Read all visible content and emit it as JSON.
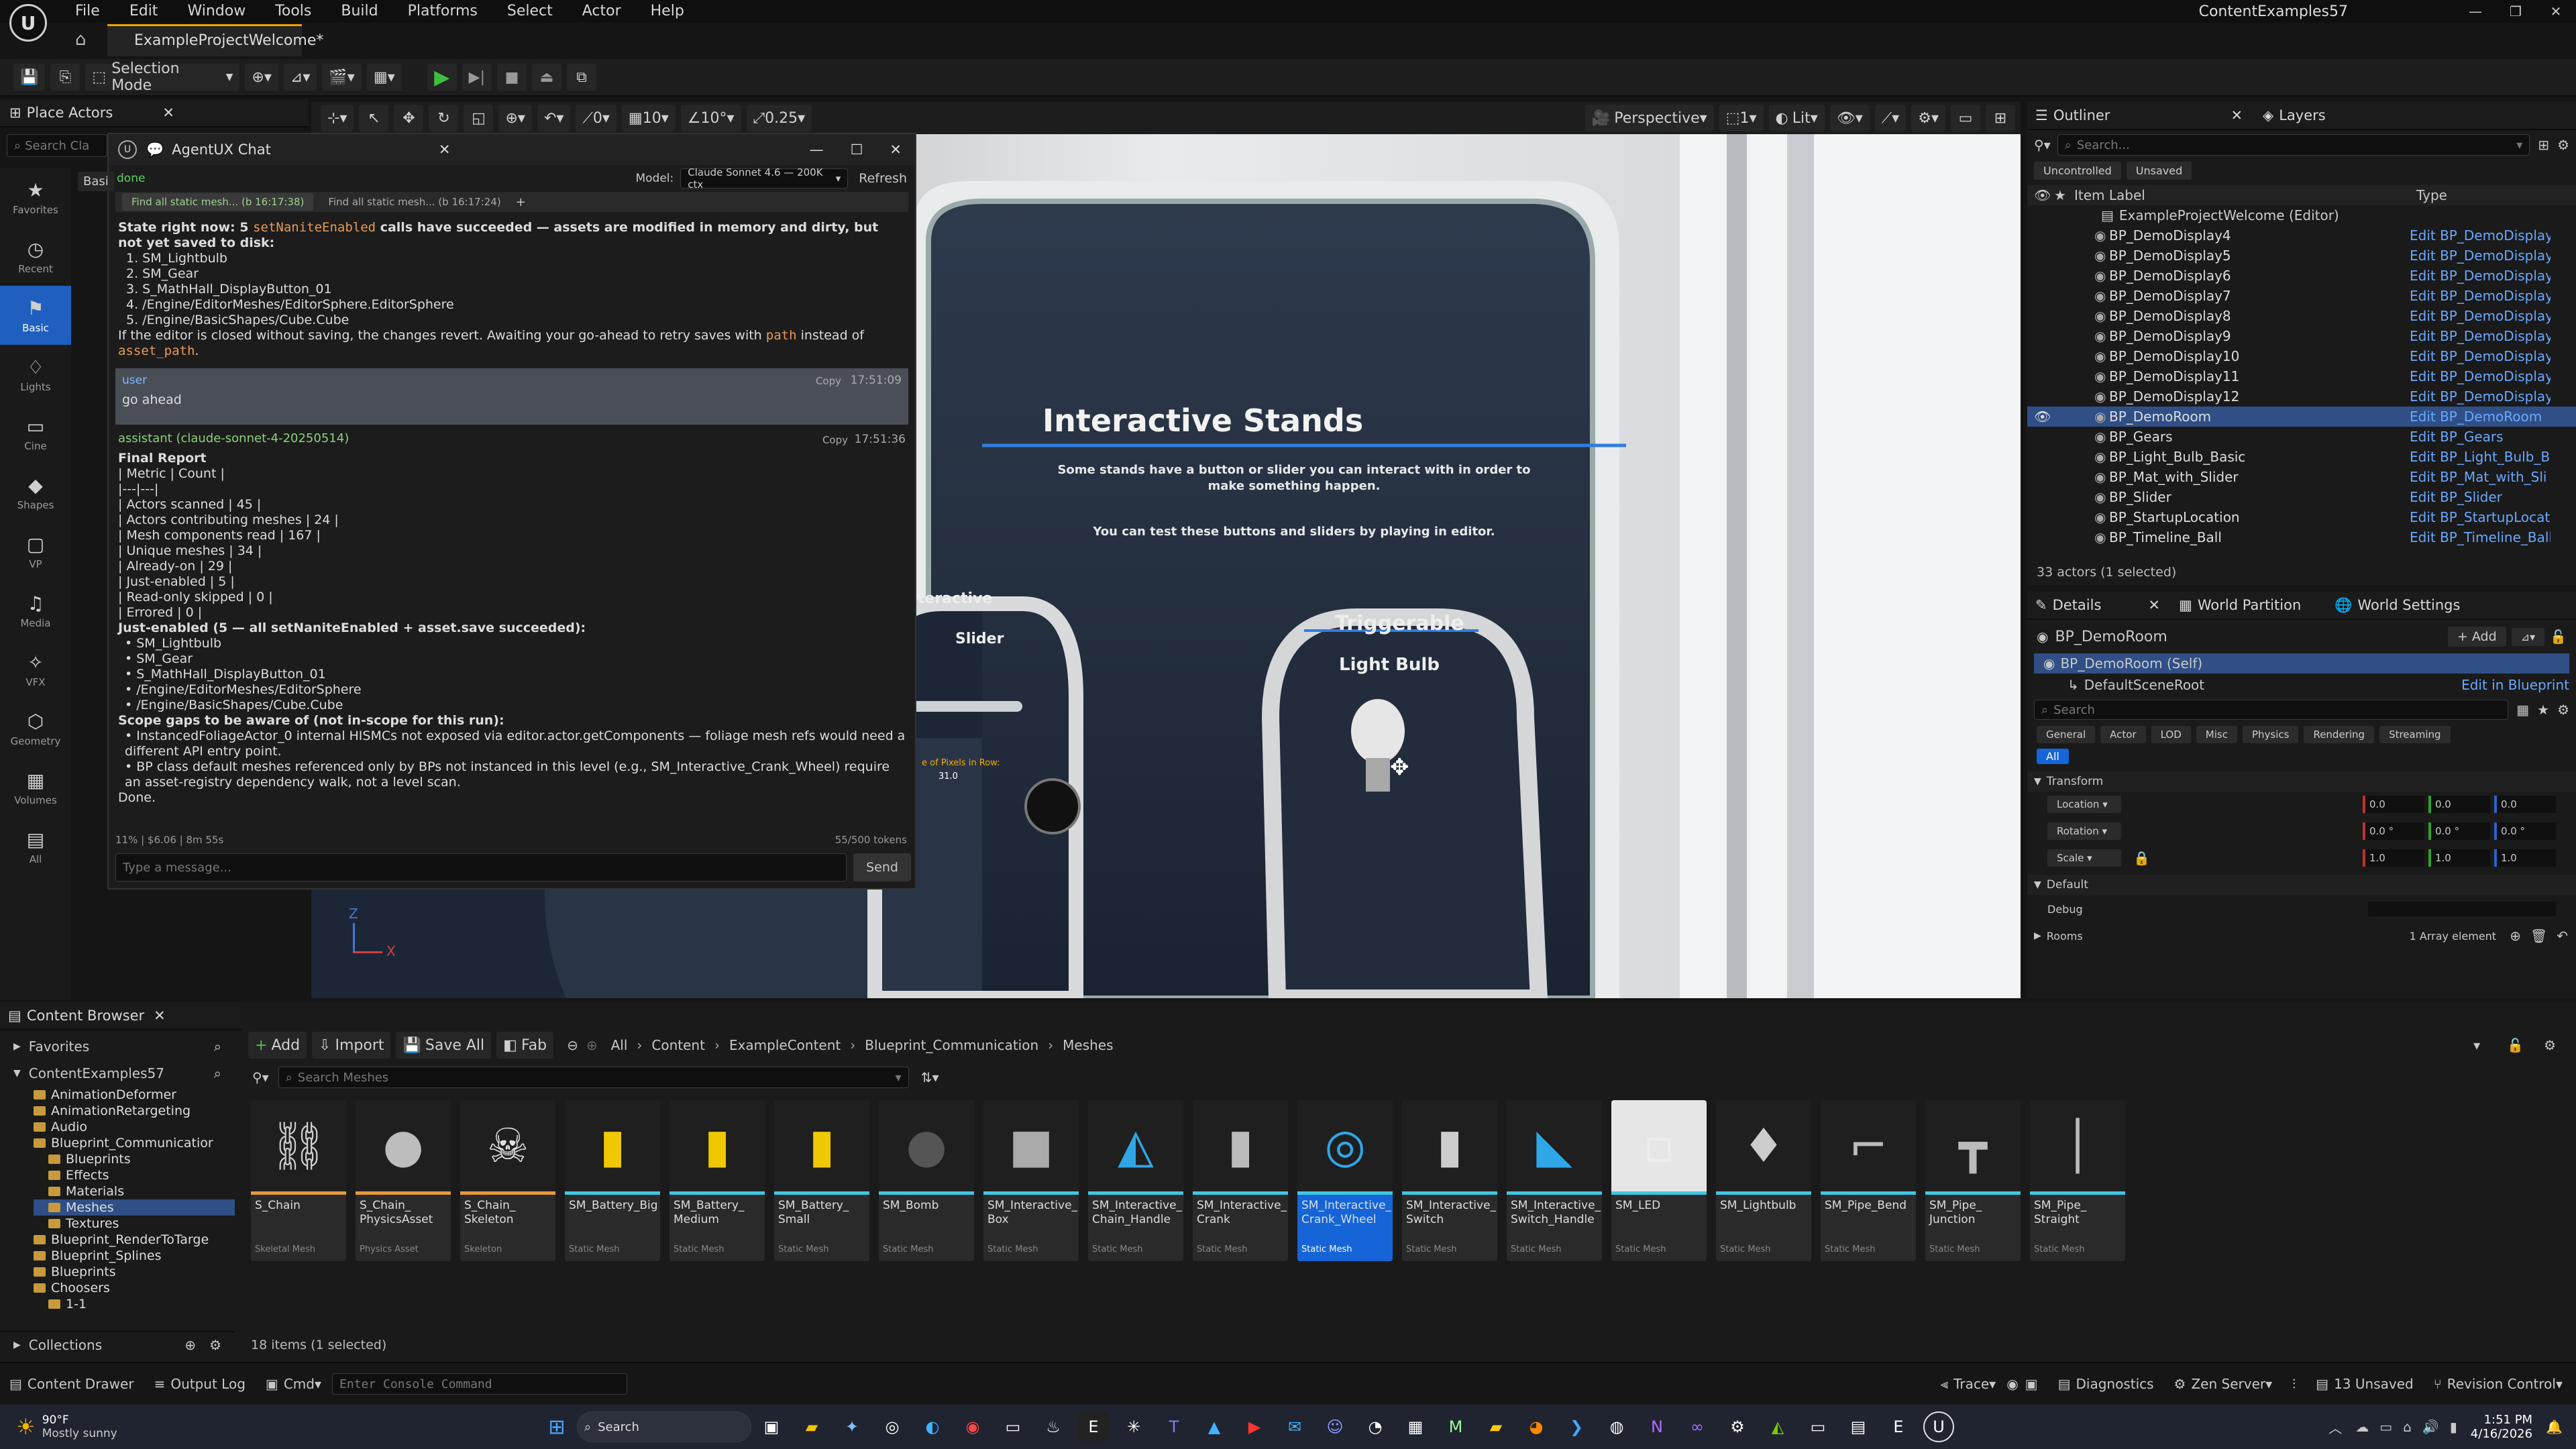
{
  "menu": {
    "items": [
      "File",
      "Edit",
      "Window",
      "Tools",
      "Build",
      "Platforms",
      "Select",
      "Actor",
      "Help"
    ],
    "project_name": "ContentExamples57"
  },
  "document_tab": {
    "label": "ExampleProjectWelcome*"
  },
  "toolbar": {
    "selection_mode": "Selection Mode"
  },
  "viewport_toolbar": {
    "snap_translate": "10",
    "snap_rotate": "10°",
    "snap_scale": "0.25",
    "angle_value": "0",
    "perspective": "Perspective",
    "lit": "Lit",
    "camera_speed": "1"
  },
  "place_actors": {
    "tab_label": "Place Actors",
    "search_placeholder": "Search Cla",
    "tab_basic": "Basi",
    "rail": [
      "Favorites",
      "Recent",
      "Basic",
      "Lights",
      "Cine",
      "Shapes",
      "VP",
      "Media",
      "VFX",
      "Geometry",
      "Volumes",
      "All"
    ]
  },
  "chat": {
    "title": "AgentUX Chat",
    "status": "done",
    "model_label": "Model:",
    "model_value": "Claude Sonnet 4.6 — 200K ctx",
    "refresh": "Refresh",
    "tabs": [
      "Find all static mesh... (b 16:17:38)",
      "Find all static mesh... (b 16:17:24)",
      "+"
    ],
    "state_pre": "State right now: 5 ",
    "state_code": "setNaniteEnabled",
    "state_mid": " calls have succeeded — assets are modified in memory and dirty, but ",
    "state_bold": "not yet saved to disk",
    "state_end": ":",
    "state_list": [
      "1. SM_Lightbulb",
      "2. SM_Gear",
      "3. S_MathHall_DisplayButton_01",
      "4. /Engine/EditorMeshes/EditorSphere.EditorSphere",
      "5. /Engine/BasicShapes/Cube.Cube"
    ],
    "state_footer_a": "If the editor is closed without saving, the changes revert. Awaiting your go-ahead to retry saves with ",
    "state_footer_code1": "path",
    "state_footer_b": " instead of ",
    "state_footer_code2": "asset_path",
    "state_footer_c": ".",
    "user_role": "user",
    "user_copy": "Copy",
    "user_time": "17:51:09",
    "user_text": "go ahead",
    "assistant_role": "assistant (claude-sonnet-4-20250514)",
    "assistant_copy": "Copy",
    "assistant_time": "17:51:36",
    "assistant_title": "Final Report",
    "report_lines": [
      "| Metric | Count |",
      "|---|---|",
      "| Actors scanned | 45 |",
      "| Actors contributing meshes | 24 |",
      "| Mesh components read | 167 |",
      "| Unique meshes | 34 |",
      "| Already-on | 29 |",
      "| Just-enabled | 5 |",
      "| Read-only skipped | 0 |",
      "| Errored | 0 |"
    ],
    "just_enabled_title": "Just-enabled (5 — all setNaniteEnabled + asset.save succeeded):",
    "just_enabled": [
      "SM_Lightbulb",
      "SM_Gear",
      "S_MathHall_DisplayButton_01",
      "/Engine/EditorMeshes/EditorSphere",
      "/Engine/BasicShapes/Cube.Cube"
    ],
    "scope_title": "Scope gaps to be aware of (not in-scope for this run):",
    "scope_items": [
      "InstancedFoliageActor_0 internal HISMCs not exposed via editor.actor.getComponents — foliage mesh refs would need a different API entry point.",
      "BP class default meshes referenced only by BPs not instanced in this level (e.g., SM_Interactive_Crank_Wheel) require an asset-registry dependency walk, not a level scan."
    ],
    "done": "Done.",
    "footer_stats": "11% | $6.06 | 8m 55s",
    "footer_tokens": "55/500 tokens",
    "input_placeholder": "Type a message...",
    "send": "Send"
  },
  "scene": {
    "title": "Interactive Stands",
    "line1": "Some stands have a button or slider you can interact with in order to",
    "line2": "make something happen.",
    "line3": "You can test these buttons and sliders by playing in editor.",
    "stand1_a": "Interactive",
    "stand1_b": "Slider",
    "stand1_c": "e of Pixels in Row:",
    "stand1_d": "31.0",
    "stand2_a": "Triggerable",
    "stand2_b": "Light Bulb"
  },
  "outliner": {
    "tab": "Outliner",
    "layers_tab": "Layers",
    "search_placeholder": "Search...",
    "filter_uncontrolled": "Uncontrolled",
    "filter_unsaved": "Unsaved",
    "col_label": "Item Label",
    "col_type": "Type",
    "root": "ExampleProjectWelcome (Editor)",
    "rows": [
      {
        "label": "BP_DemoDisplay4",
        "type": "Edit BP_DemoDisplay"
      },
      {
        "label": "BP_DemoDisplay5",
        "type": "Edit BP_DemoDisplay"
      },
      {
        "label": "BP_DemoDisplay6",
        "type": "Edit BP_DemoDisplay"
      },
      {
        "label": "BP_DemoDisplay7",
        "type": "Edit BP_DemoDisplay"
      },
      {
        "label": "BP_DemoDisplay8",
        "type": "Edit BP_DemoDisplay"
      },
      {
        "label": "BP_DemoDisplay9",
        "type": "Edit BP_DemoDisplay"
      },
      {
        "label": "BP_DemoDisplay10",
        "type": "Edit BP_DemoDisplay"
      },
      {
        "label": "BP_DemoDisplay11",
        "type": "Edit BP_DemoDisplay"
      },
      {
        "label": "BP_DemoDisplay12",
        "type": "Edit BP_DemoDisplay"
      },
      {
        "label": "BP_DemoRoom",
        "type": "Edit BP_DemoRoom"
      },
      {
        "label": "BP_Gears",
        "type": "Edit BP_Gears"
      },
      {
        "label": "BP_Light_Bulb_Basic",
        "type": "Edit BP_Light_Bulb_B"
      },
      {
        "label": "BP_Mat_with_Slider",
        "type": "Edit BP_Mat_with_Sli"
      },
      {
        "label": "BP_Slider",
        "type": "Edit BP_Slider"
      },
      {
        "label": "BP_StartupLocation",
        "type": "Edit BP_StartupLocat"
      },
      {
        "label": "BP_Timeline_Ball",
        "type": "Edit BP_Timeline_Ball"
      }
    ],
    "count": "33 actors (1 selected)"
  },
  "details": {
    "tab": "Details",
    "world_partition_tab": "World Partition",
    "world_settings_tab": "World Settings",
    "actor_name": "BP_DemoRoom",
    "add": "+ Add",
    "self_row": "BP_DemoRoom (Self)",
    "scene_root": "DefaultSceneRoot",
    "edit_bp": "Edit in Blueprint",
    "search_placeholder": "Search",
    "filters": [
      "General",
      "Actor",
      "LOD",
      "Misc",
      "Physics",
      "Rendering",
      "Streaming"
    ],
    "filter_all": "All",
    "section_transform": "Transform",
    "location": "Location",
    "rotation": "Rotation",
    "scale": "Scale",
    "loc": [
      "0.0",
      "0.0",
      "0.0"
    ],
    "rot": [
      "0.0 °",
      "0.0 °",
      "0.0 °"
    ],
    "scl": [
      "1.0",
      "1.0",
      "1.0"
    ],
    "section_default": "Default",
    "debug": "Debug",
    "rooms": "Rooms",
    "rooms_value": "1 Array element"
  },
  "content_browser": {
    "tab": "Content Browser",
    "favorites": "Favorites",
    "project": "ContentExamples57",
    "add": "Add",
    "import": "Import",
    "save_all": "Save All",
    "fab": "Fab",
    "breadcrumb": [
      "All",
      "Content",
      "ExampleContent",
      "Blueprint_Communication",
      "Meshes"
    ],
    "search_placeholder": "Search Meshes",
    "tree": [
      {
        "label": "AnimationDeformer",
        "depth": 1
      },
      {
        "label": "AnimationRetargeting",
        "depth": 1
      },
      {
        "label": "Audio",
        "depth": 1
      },
      {
        "label": "Blueprint_Communicatior",
        "depth": 1
      },
      {
        "label": "Blueprints",
        "depth": 2
      },
      {
        "label": "Effects",
        "depth": 2
      },
      {
        "label": "Materials",
        "depth": 2
      },
      {
        "label": "Meshes",
        "depth": 2
      },
      {
        "label": "Textures",
        "depth": 2
      },
      {
        "label": "Blueprint_RenderToTarge",
        "depth": 1
      },
      {
        "label": "Blueprint_Splines",
        "depth": 1
      },
      {
        "label": "Blueprints",
        "depth": 1
      },
      {
        "label": "Choosers",
        "depth": 1
      },
      {
        "label": "1-1",
        "depth": 2
      }
    ],
    "collections": "Collections",
    "assets": [
      {
        "name": "S_Chain",
        "kind": "Skeletal Mesh",
        "icon": "⛓",
        "color": "#d0d0d0"
      },
      {
        "name": "S_Chain_ PhysicsAsset",
        "kind": "Physics Asset",
        "icon": "●",
        "color": "#bdbdbd"
      },
      {
        "name": "S_Chain_ Skeleton",
        "kind": "Skeleton",
        "icon": "☠",
        "color": "#e0e0e0"
      },
      {
        "name": "SM_Battery_Big",
        "kind": "Static Mesh",
        "icon": "▮",
        "color": "#f0c800"
      },
      {
        "name": "SM_Battery_ Medium",
        "kind": "Static Mesh",
        "icon": "▮",
        "color": "#f0c800"
      },
      {
        "name": "SM_Battery_ Small",
        "kind": "Static Mesh",
        "icon": "▮",
        "color": "#f0c800"
      },
      {
        "name": "SM_Bomb",
        "kind": "Static Mesh",
        "icon": "●",
        "color": "#555"
      },
      {
        "name": "SM_Interactive_ Box",
        "kind": "Static Mesh",
        "icon": "■",
        "color": "#aaa"
      },
      {
        "name": "SM_Interactive_ Chain_Handle",
        "kind": "Static Mesh",
        "icon": "◭",
        "color": "#2fa6e6"
      },
      {
        "name": "SM_Interactive_ Crank",
        "kind": "Static Mesh",
        "icon": "▮",
        "color": "#bbb"
      },
      {
        "name": "SM_Interactive_ Crank_Wheel",
        "kind": "Static Mesh",
        "icon": "◎",
        "color": "#2fa6e6"
      },
      {
        "name": "SM_Interactive_ Switch",
        "kind": "Static Mesh",
        "icon": "▮",
        "color": "#ccc"
      },
      {
        "name": "SM_Interactive_ Switch_Handle",
        "kind": "Static Mesh",
        "icon": "◣",
        "color": "#2fa6e6"
      },
      {
        "name": "SM_LED",
        "kind": "Static Mesh",
        "icon": "▫",
        "color": "#eee"
      },
      {
        "name": "SM_Lightbulb",
        "kind": "Static Mesh",
        "icon": "♦",
        "color": "#ccc"
      },
      {
        "name": "SM_Pipe_Bend",
        "kind": "Static Mesh",
        "icon": "⌐",
        "color": "#bbb"
      },
      {
        "name": "SM_Pipe_ Junction",
        "kind": "Static Mesh",
        "icon": "┳",
        "color": "#bbb"
      },
      {
        "name": "SM_Pipe_ Straight",
        "kind": "Static Mesh",
        "icon": "│",
        "color": "#bbb"
      }
    ],
    "selected_index": 10,
    "count": "18 items (1 selected)"
  },
  "statusbar": {
    "content_drawer": "Content Drawer",
    "output_log": "Output Log",
    "cmd": "Cmd",
    "console_placeholder": "Enter Console Command",
    "trace": "Trace",
    "diagnostics": "Diagnostics",
    "zen": "Zen Server",
    "unsaved": "13 Unsaved",
    "revision": "Revision Control"
  },
  "taskbar": {
    "temp": "90°F",
    "weather": "Mostly sunny",
    "search": "Search",
    "time": "1:51 PM",
    "date": "4/16/2026"
  }
}
